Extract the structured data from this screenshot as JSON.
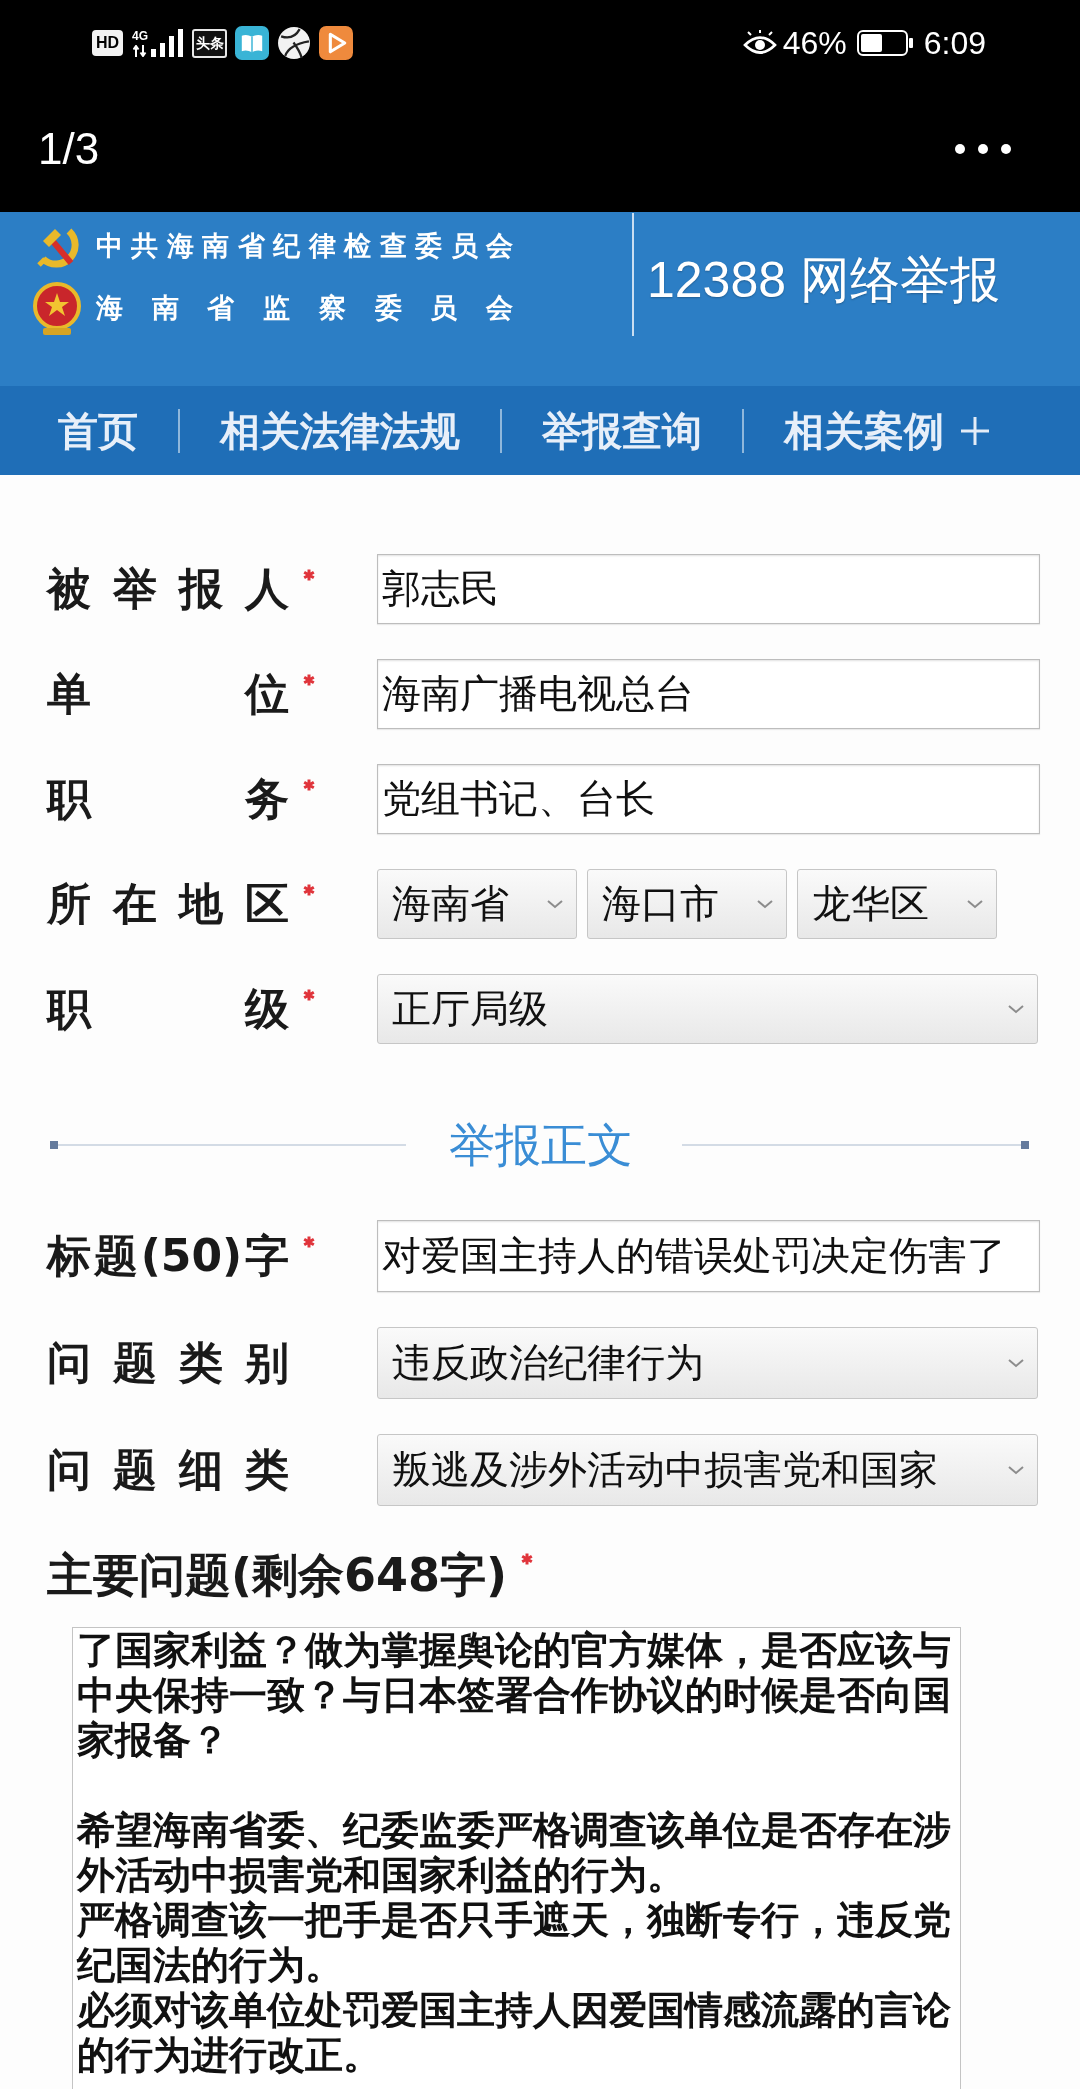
{
  "status_bar": {
    "hd_badge": "HD",
    "network_type": "4G",
    "app_icons": [
      {
        "kind": "text",
        "label": "头条"
      },
      {
        "kind": "book"
      },
      {
        "kind": "ball"
      },
      {
        "kind": "play"
      }
    ],
    "battery_percent": "46%",
    "time": "6:09"
  },
  "viewer_bar": {
    "page_counter": "1/3"
  },
  "site_header": {
    "org_names": [
      "中共海南省纪律检查委员会",
      "海南省监察委员会"
    ],
    "title": "12388 网络举报"
  },
  "nav": {
    "items": [
      "首页",
      "相关法律法规",
      "举报查询",
      "相关案例"
    ]
  },
  "reported_person": {
    "fields": [
      {
        "kind": "input",
        "label": "被举报人",
        "required": true,
        "value": "郭志民"
      },
      {
        "kind": "input",
        "label": "单位",
        "required": true,
        "value": "海南广播电视总台"
      },
      {
        "kind": "input",
        "label": "职务",
        "required": true,
        "value": "党组书记、台长"
      },
      {
        "kind": "region",
        "label": "所在地区",
        "required": true,
        "selects": [
          "海南省",
          "海口市",
          "龙华区"
        ]
      },
      {
        "kind": "select",
        "label": "职级",
        "required": true,
        "value": "正厅局级"
      }
    ]
  },
  "report_body": {
    "section_title": "举报正文",
    "fields": [
      {
        "kind": "input",
        "label": "标题(50)字",
        "required": true,
        "value": "对爱国主持人的错误处罚决定伤害了"
      },
      {
        "kind": "select",
        "label": "问题类别",
        "required": false,
        "value": "违反政治纪律行为"
      },
      {
        "kind": "select",
        "label": "问题细类",
        "required": false,
        "value": "叛逃及涉外活动中损害党和国家"
      }
    ],
    "main_issue": {
      "label": "主要问题(剩余648字)",
      "required": true,
      "text_blocks": [
        [
          "了国家利益？做为掌握舆论的官方媒体，是否应该与中央保持一致？与日本签署合作协议的时候是否向国家报备？"
        ],
        [
          "希望海南省委、纪委监委严格调查该单位是否存在涉外活动中损害党和国家利益的行为。",
          "严格调查该一把手是否只手遮天，独断专行，违反党纪国法的行为。",
          "必须对该单位处罚爱国主持人因爱国情感流露的言论的行为进行改正。"
        ]
      ]
    }
  }
}
